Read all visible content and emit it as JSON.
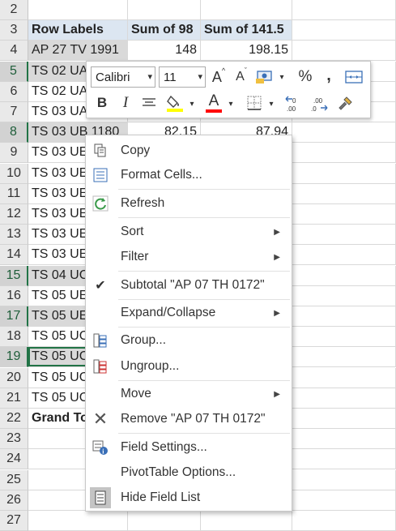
{
  "sheet": {
    "rows": [
      {
        "num": "2",
        "a": "",
        "b": "",
        "c": ""
      },
      {
        "num": "3",
        "a": "Row Labels",
        "b": "Sum of 98",
        "c": "Sum of 141.5"
      },
      {
        "num": "4",
        "a": "AP 27 TV 1991",
        "b": "148",
        "c": "198.15"
      },
      {
        "num": "5",
        "a": "TS 02 UA",
        "b": "",
        "c": ""
      },
      {
        "num": "6",
        "a": "TS 02 UA",
        "b": "",
        "c": ""
      },
      {
        "num": "7",
        "a": "TS 03 UA",
        "b": "",
        "c": ""
      },
      {
        "num": "8",
        "a": "TS 03 UB 1180",
        "b": "82.15",
        "c": "87.94"
      },
      {
        "num": "9",
        "a": "TS 03 UE",
        "b": "",
        "c": ""
      },
      {
        "num": "10",
        "a": "TS 03 UE",
        "b": "",
        "c": ""
      },
      {
        "num": "11",
        "a": "TS 03 UE",
        "b": "",
        "c": ""
      },
      {
        "num": "12",
        "a": "TS 03 UE",
        "b": "",
        "c": ""
      },
      {
        "num": "13",
        "a": "TS 03 UE",
        "b": "",
        "c": ""
      },
      {
        "num": "14",
        "a": "TS 03 UE",
        "b": "",
        "c": ""
      },
      {
        "num": "15",
        "a": "TS 04 UC",
        "b": "",
        "c": ""
      },
      {
        "num": "16",
        "a": "TS 05 UE",
        "b": "",
        "c": ""
      },
      {
        "num": "17",
        "a": "TS 05 UE",
        "b": "",
        "c": ""
      },
      {
        "num": "18",
        "a": "TS 05 UC",
        "b": "",
        "c": ""
      },
      {
        "num": "19",
        "a": "TS 05 UC",
        "b": "",
        "c": ""
      },
      {
        "num": "20",
        "a": "TS 05 UC",
        "b": "",
        "c": ""
      },
      {
        "num": "21",
        "a": "TS 05 UC",
        "b": "",
        "c": ""
      },
      {
        "num": "22",
        "a": "Grand To",
        "b": "",
        "c": ""
      },
      {
        "num": "23",
        "a": "",
        "b": "",
        "c": ""
      },
      {
        "num": "24",
        "a": "",
        "b": "",
        "c": ""
      },
      {
        "num": "25",
        "a": "",
        "b": "",
        "c": ""
      },
      {
        "num": "26",
        "a": "",
        "b": "",
        "c": ""
      },
      {
        "num": "27",
        "a": "",
        "b": "",
        "c": ""
      }
    ]
  },
  "mini_toolbar": {
    "font_name": "Calibri",
    "font_size": "11",
    "percent": "%",
    "comma": ",",
    "inc_font": "A",
    "dec_font": "A",
    "bold": "B",
    "italic": "I",
    "font_color": "A",
    "highlight_color": "#ffff00",
    "font_color_bar": "#ff0000"
  },
  "menu": {
    "copy": "Copy",
    "format_cells": "Format Cells...",
    "refresh": "Refresh",
    "sort": "Sort",
    "filter": "Filter",
    "subtotal": "Subtotal \"AP 07 TH 0172\"",
    "expand_collapse": "Expand/Collapse",
    "group": "Group...",
    "ungroup": "Ungroup...",
    "move": "Move",
    "remove": "Remove \"AP 07 TH 0172\"",
    "field_settings": "Field Settings...",
    "pivot_options": "PivotTable Options...",
    "hide_field_list": "Hide Field List"
  }
}
